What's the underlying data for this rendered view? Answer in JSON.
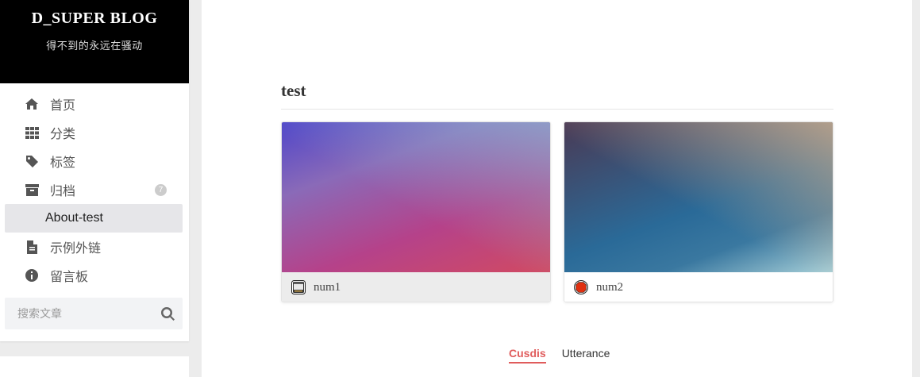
{
  "brand": {
    "title": "D_SUPER BLOG",
    "subtitle": "得不到的永远在骚动"
  },
  "menu": {
    "items": [
      {
        "label": "首页",
        "icon": "home-icon"
      },
      {
        "label": "分类",
        "icon": "grid-icon"
      },
      {
        "label": "标签",
        "icon": "tag-icon"
      },
      {
        "label": "归档",
        "icon": "archive-icon",
        "badge": "7"
      },
      {
        "label": "About-test",
        "active": true
      },
      {
        "label": "示例外链",
        "icon": "file-icon"
      },
      {
        "label": "留言板",
        "icon": "info-icon"
      }
    ]
  },
  "search": {
    "placeholder": "搜索文章",
    "icon": "search-icon"
  },
  "post": {
    "title": "test",
    "cards": [
      {
        "label": "num1",
        "icon": "window-icon"
      },
      {
        "label": "num2",
        "icon": "stop-icon"
      }
    ]
  },
  "comments": {
    "tabs": [
      {
        "label": "Cusdis",
        "active": true
      },
      {
        "label": "Utterance"
      }
    ]
  },
  "colors": {
    "accent": "#e05c5c",
    "brand_bg": "#000000",
    "active_menu_bg": "#e6e6e9"
  }
}
